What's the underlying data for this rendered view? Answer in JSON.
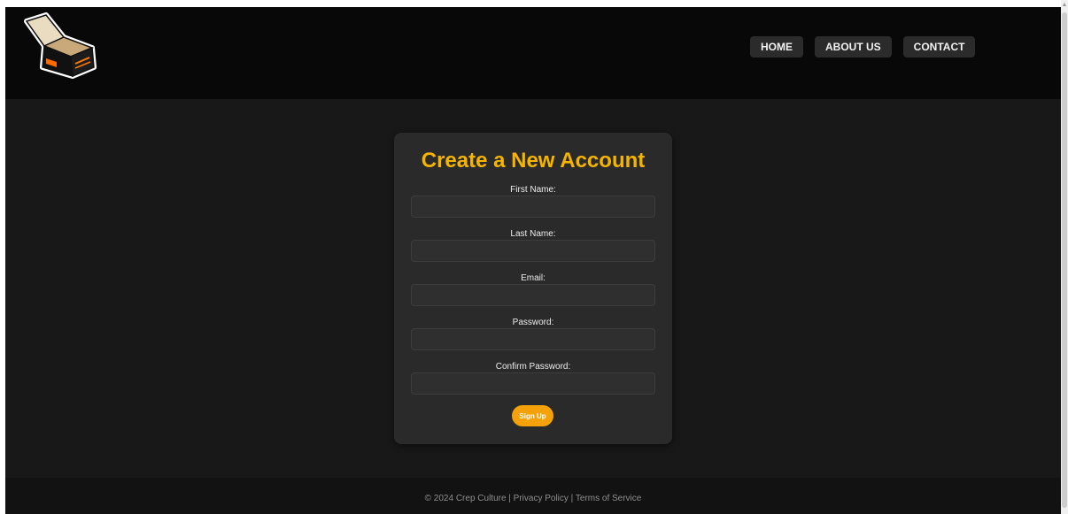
{
  "nav": {
    "items": [
      {
        "label": "HOME"
      },
      {
        "label": "ABOUT US"
      },
      {
        "label": "CONTACT"
      }
    ]
  },
  "form": {
    "title": "Create a New Account",
    "fields": [
      {
        "label": "First Name:",
        "value": "",
        "placeholder": ""
      },
      {
        "label": "Last Name:",
        "value": "",
        "placeholder": ""
      },
      {
        "label": "Email:",
        "value": "",
        "placeholder": ""
      },
      {
        "label": "Password:",
        "value": "",
        "placeholder": ""
      },
      {
        "label": "Confirm Password:",
        "value": "",
        "placeholder": ""
      }
    ],
    "submit_label": "Sign Up"
  },
  "footer": {
    "text": "© 2024 Crep Culture | Privacy Policy | Terms of Service"
  },
  "colors": {
    "accent": "#f5b400",
    "button": "#f5a20a",
    "background": "#181818",
    "header": "#080808"
  },
  "icons": {
    "logo": "shoe-box-logo"
  }
}
